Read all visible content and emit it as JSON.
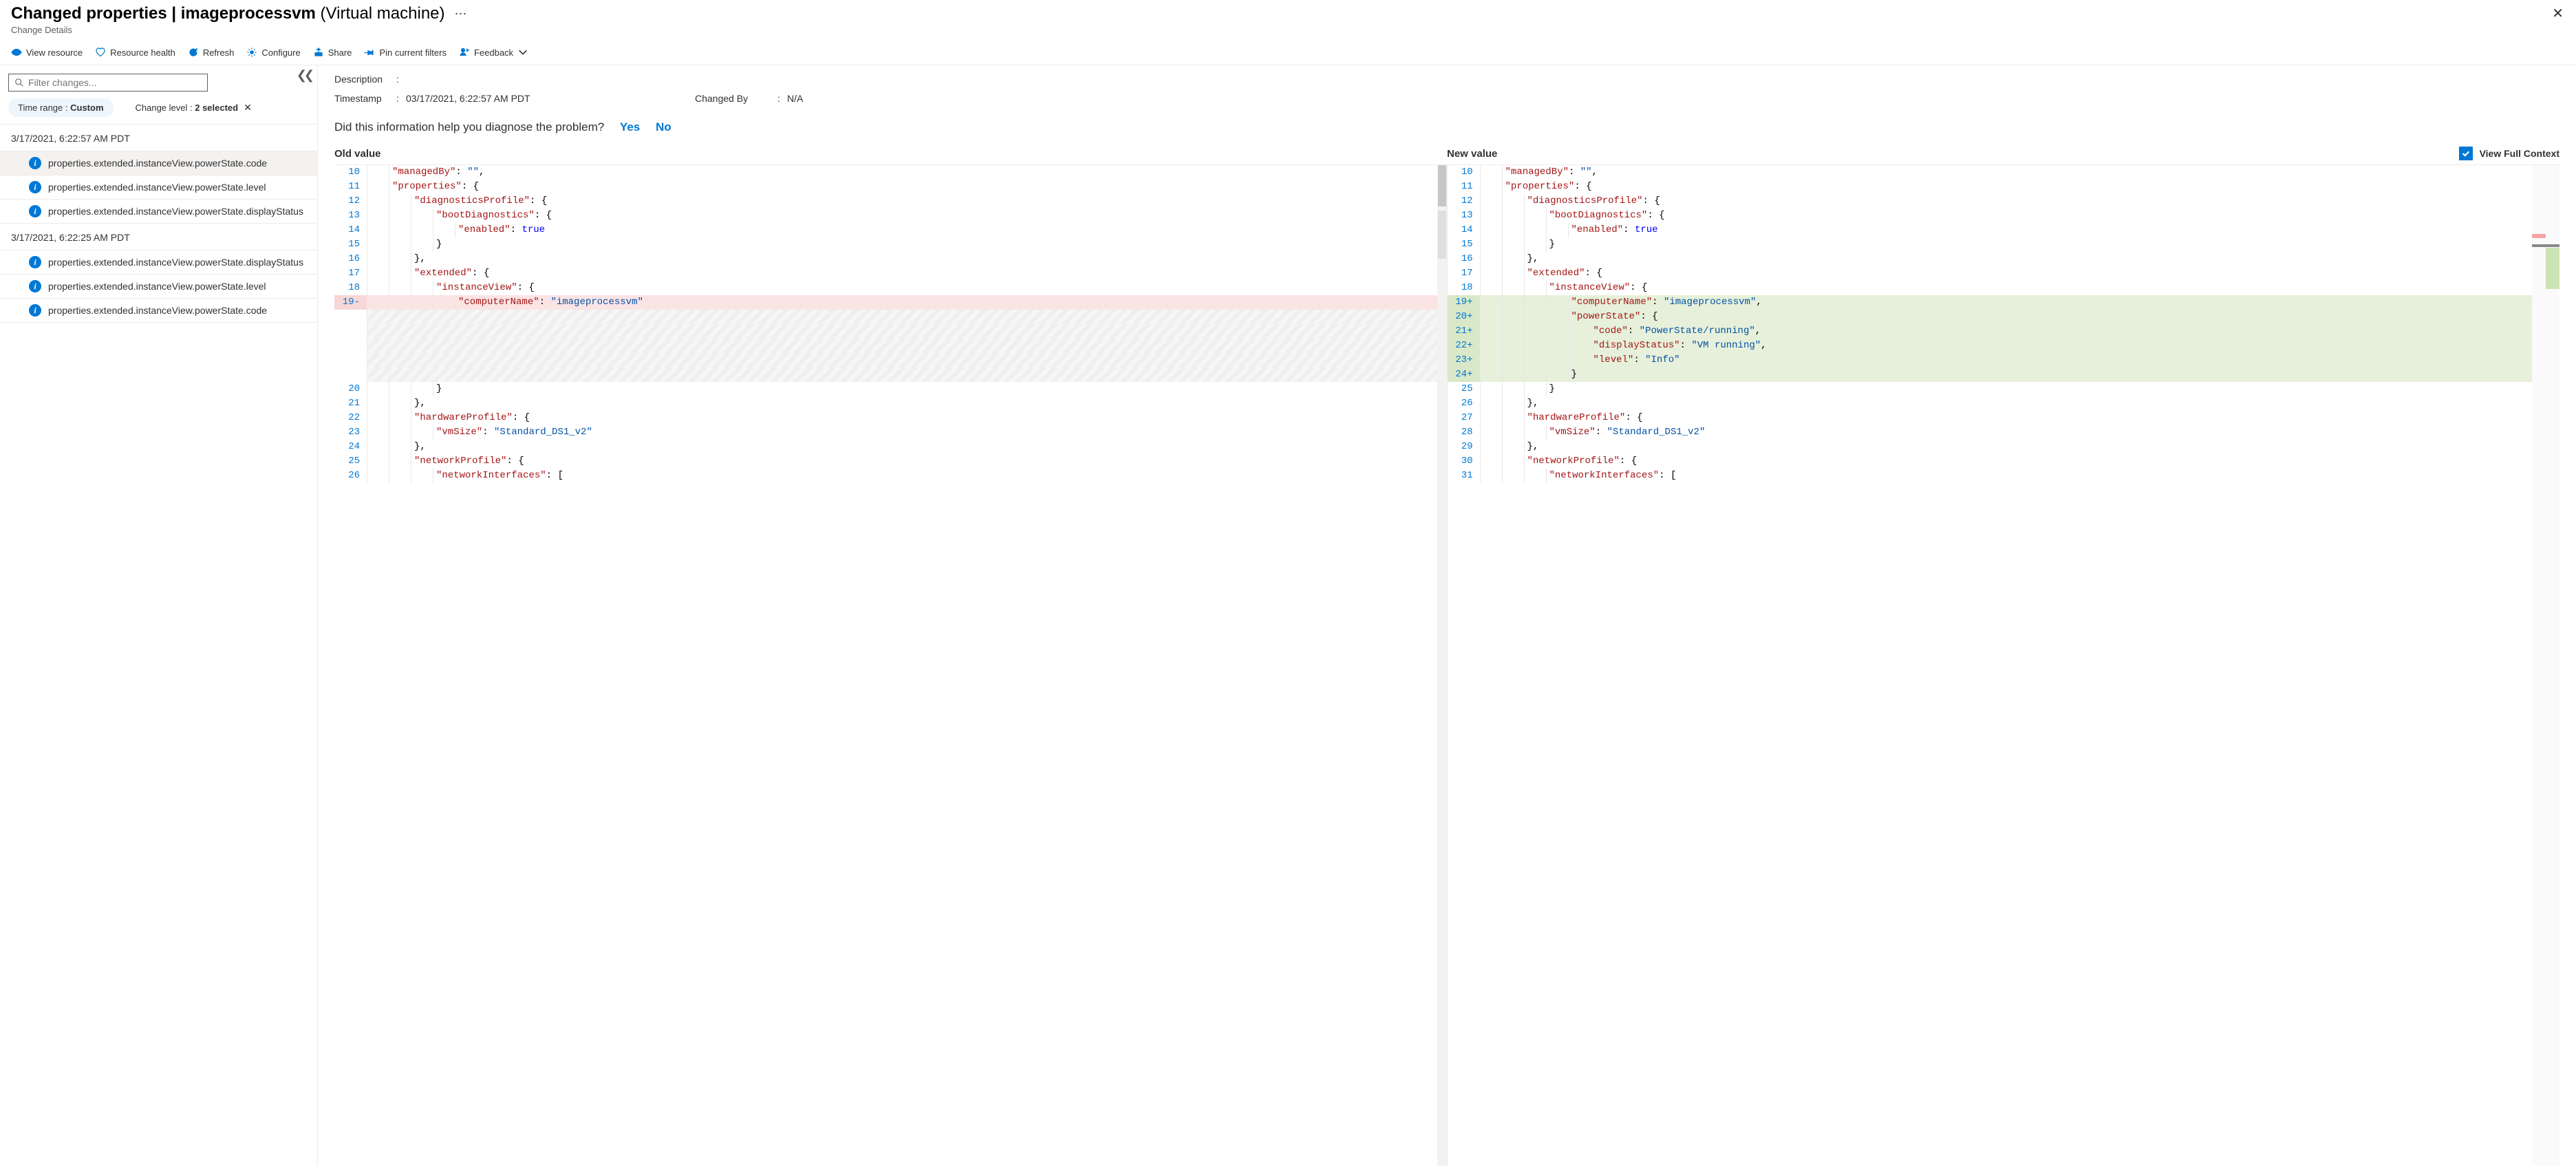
{
  "header": {
    "title_prefix": "Changed properties",
    "title_sep": " | ",
    "resource_name": "imageprocessvm",
    "resource_type": "(Virtual machine)",
    "breadcrumb": "Change Details"
  },
  "toolbar": {
    "view_resource": "View resource",
    "resource_health": "Resource health",
    "refresh": "Refresh",
    "configure": "Configure",
    "share": "Share",
    "pin": "Pin current filters",
    "feedback": "Feedback"
  },
  "sidebar": {
    "filter_placeholder": "Filter changes...",
    "pill_time_label": "Time range : ",
    "pill_time_value": "Custom",
    "pill_level_label": "Change level : ",
    "pill_level_value": "2 selected",
    "groups": [
      {
        "timestamp": "3/17/2021, 6:22:57 AM PDT",
        "items": [
          {
            "label": "properties.extended.instanceView.powerState.code",
            "selected": true
          },
          {
            "label": "properties.extended.instanceView.powerState.level",
            "selected": false
          },
          {
            "label": "properties.extended.instanceView.powerState.displayStatus",
            "selected": false
          }
        ]
      },
      {
        "timestamp": "3/17/2021, 6:22:25 AM PDT",
        "items": [
          {
            "label": "properties.extended.instanceView.powerState.displayStatus",
            "selected": false
          },
          {
            "label": "properties.extended.instanceView.powerState.level",
            "selected": false
          },
          {
            "label": "properties.extended.instanceView.powerState.code",
            "selected": false
          }
        ]
      }
    ]
  },
  "main": {
    "meta": {
      "description_label": "Description",
      "description_value": "",
      "timestamp_label": "Timestamp",
      "timestamp_value": "03/17/2021, 6:22:57 AM PDT",
      "changed_by_label": "Changed By",
      "changed_by_value": "N/A"
    },
    "feedback_q": "Did this information help you diagnose the problem?",
    "yes": "Yes",
    "no": "No",
    "old_header": "Old value",
    "new_header": "New value",
    "full_ctx": "View Full Context",
    "full_ctx_checked": true
  },
  "diff": {
    "old": [
      {
        "n": "10",
        "ind": 1,
        "tokens": [
          [
            "key",
            "\"managedBy\""
          ],
          [
            "pun",
            ": "
          ],
          [
            "str",
            "\"\""
          ],
          [
            "pun",
            ","
          ]
        ]
      },
      {
        "n": "11",
        "ind": 1,
        "tokens": [
          [
            "key",
            "\"properties\""
          ],
          [
            "pun",
            ": {"
          ]
        ]
      },
      {
        "n": "12",
        "ind": 2,
        "tokens": [
          [
            "key",
            "\"diagnosticsProfile\""
          ],
          [
            "pun",
            ": {"
          ]
        ]
      },
      {
        "n": "13",
        "ind": 3,
        "tokens": [
          [
            "key",
            "\"bootDiagnostics\""
          ],
          [
            "pun",
            ": {"
          ]
        ]
      },
      {
        "n": "14",
        "ind": 4,
        "tokens": [
          [
            "key",
            "\"enabled\""
          ],
          [
            "pun",
            ": "
          ],
          [
            "kw",
            "true"
          ]
        ]
      },
      {
        "n": "15",
        "ind": 3,
        "tokens": [
          [
            "pun",
            "}"
          ]
        ]
      },
      {
        "n": "16",
        "ind": 2,
        "tokens": [
          [
            "pun",
            "},"
          ]
        ]
      },
      {
        "n": "17",
        "ind": 2,
        "tokens": [
          [
            "key",
            "\"extended\""
          ],
          [
            "pun",
            ": {"
          ]
        ]
      },
      {
        "n": "18",
        "ind": 3,
        "tokens": [
          [
            "key",
            "\"instanceView\""
          ],
          [
            "pun",
            ": {"
          ]
        ]
      },
      {
        "n": "19",
        "ind": 4,
        "cls": "removed",
        "mark": "-",
        "tokens": [
          [
            "key",
            "\"computerName\""
          ],
          [
            "pun",
            ": "
          ],
          [
            "str",
            "\"imageprocessvm\""
          ]
        ]
      },
      {
        "n": "",
        "ind": 0,
        "cls": "hatched",
        "tokens": []
      },
      {
        "n": "",
        "ind": 0,
        "cls": "hatched",
        "tokens": []
      },
      {
        "n": "",
        "ind": 0,
        "cls": "hatched",
        "tokens": []
      },
      {
        "n": "",
        "ind": 0,
        "cls": "hatched",
        "tokens": []
      },
      {
        "n": "",
        "ind": 0,
        "cls": "hatched",
        "tokens": []
      },
      {
        "n": "20",
        "ind": 3,
        "tokens": [
          [
            "pun",
            "}"
          ]
        ]
      },
      {
        "n": "21",
        "ind": 2,
        "tokens": [
          [
            "pun",
            "},"
          ]
        ]
      },
      {
        "n": "22",
        "ind": 2,
        "tokens": [
          [
            "key",
            "\"hardwareProfile\""
          ],
          [
            "pun",
            ": {"
          ]
        ]
      },
      {
        "n": "23",
        "ind": 3,
        "tokens": [
          [
            "key",
            "\"vmSize\""
          ],
          [
            "pun",
            ": "
          ],
          [
            "str",
            "\"Standard_DS1_v2\""
          ]
        ]
      },
      {
        "n": "24",
        "ind": 2,
        "tokens": [
          [
            "pun",
            "},"
          ]
        ]
      },
      {
        "n": "25",
        "ind": 2,
        "tokens": [
          [
            "key",
            "\"networkProfile\""
          ],
          [
            "pun",
            ": {"
          ]
        ]
      },
      {
        "n": "26",
        "ind": 3,
        "tokens": [
          [
            "key",
            "\"networkInterfaces\""
          ],
          [
            "pun",
            ": ["
          ]
        ]
      }
    ],
    "new": [
      {
        "n": "10",
        "ind": 1,
        "tokens": [
          [
            "key",
            "\"managedBy\""
          ],
          [
            "pun",
            ": "
          ],
          [
            "str",
            "\"\""
          ],
          [
            "pun",
            ","
          ]
        ]
      },
      {
        "n": "11",
        "ind": 1,
        "tokens": [
          [
            "key",
            "\"properties\""
          ],
          [
            "pun",
            ": {"
          ]
        ]
      },
      {
        "n": "12",
        "ind": 2,
        "tokens": [
          [
            "key",
            "\"diagnosticsProfile\""
          ],
          [
            "pun",
            ": {"
          ]
        ]
      },
      {
        "n": "13",
        "ind": 3,
        "tokens": [
          [
            "key",
            "\"bootDiagnostics\""
          ],
          [
            "pun",
            ": {"
          ]
        ]
      },
      {
        "n": "14",
        "ind": 4,
        "tokens": [
          [
            "key",
            "\"enabled\""
          ],
          [
            "pun",
            ": "
          ],
          [
            "kw",
            "true"
          ]
        ]
      },
      {
        "n": "15",
        "ind": 3,
        "tokens": [
          [
            "pun",
            "}"
          ]
        ]
      },
      {
        "n": "16",
        "ind": 2,
        "tokens": [
          [
            "pun",
            "},"
          ]
        ]
      },
      {
        "n": "17",
        "ind": 2,
        "tokens": [
          [
            "key",
            "\"extended\""
          ],
          [
            "pun",
            ": {"
          ]
        ]
      },
      {
        "n": "18",
        "ind": 3,
        "tokens": [
          [
            "key",
            "\"instanceView\""
          ],
          [
            "pun",
            ": {"
          ]
        ]
      },
      {
        "n": "19",
        "ind": 4,
        "cls": "added",
        "mark": "+",
        "tokens": [
          [
            "key",
            "\"computerName\""
          ],
          [
            "pun",
            ": "
          ],
          [
            "str",
            "\"imageprocessvm\""
          ],
          [
            "pun",
            ","
          ]
        ]
      },
      {
        "n": "20",
        "ind": 4,
        "cls": "added",
        "mark": "+",
        "tokens": [
          [
            "key",
            "\"powerState\""
          ],
          [
            "pun",
            ": {"
          ]
        ]
      },
      {
        "n": "21",
        "ind": 5,
        "cls": "added",
        "mark": "+",
        "tokens": [
          [
            "key",
            "\"code\""
          ],
          [
            "pun",
            ": "
          ],
          [
            "str",
            "\"PowerState/running\""
          ],
          [
            "pun",
            ","
          ]
        ]
      },
      {
        "n": "22",
        "ind": 5,
        "cls": "added",
        "mark": "+",
        "tokens": [
          [
            "key",
            "\"displayStatus\""
          ],
          [
            "pun",
            ": "
          ],
          [
            "str",
            "\"VM running\""
          ],
          [
            "pun",
            ","
          ]
        ]
      },
      {
        "n": "23",
        "ind": 5,
        "cls": "added",
        "mark": "+",
        "tokens": [
          [
            "key",
            "\"level\""
          ],
          [
            "pun",
            ": "
          ],
          [
            "str",
            "\"Info\""
          ]
        ]
      },
      {
        "n": "24",
        "ind": 4,
        "cls": "added",
        "mark": "+",
        "tokens": [
          [
            "pun",
            "}"
          ]
        ]
      },
      {
        "n": "25",
        "ind": 3,
        "tokens": [
          [
            "pun",
            "}"
          ]
        ]
      },
      {
        "n": "26",
        "ind": 2,
        "tokens": [
          [
            "pun",
            "},"
          ]
        ]
      },
      {
        "n": "27",
        "ind": 2,
        "tokens": [
          [
            "key",
            "\"hardwareProfile\""
          ],
          [
            "pun",
            ": {"
          ]
        ]
      },
      {
        "n": "28",
        "ind": 3,
        "tokens": [
          [
            "key",
            "\"vmSize\""
          ],
          [
            "pun",
            ": "
          ],
          [
            "str",
            "\"Standard_DS1_v2\""
          ]
        ]
      },
      {
        "n": "29",
        "ind": 2,
        "tokens": [
          [
            "pun",
            "},"
          ]
        ]
      },
      {
        "n": "30",
        "ind": 2,
        "tokens": [
          [
            "key",
            "\"networkProfile\""
          ],
          [
            "pun",
            ": {"
          ]
        ]
      },
      {
        "n": "31",
        "ind": 3,
        "tokens": [
          [
            "key",
            "\"networkInterfaces\""
          ],
          [
            "pun",
            ": ["
          ]
        ]
      }
    ]
  }
}
